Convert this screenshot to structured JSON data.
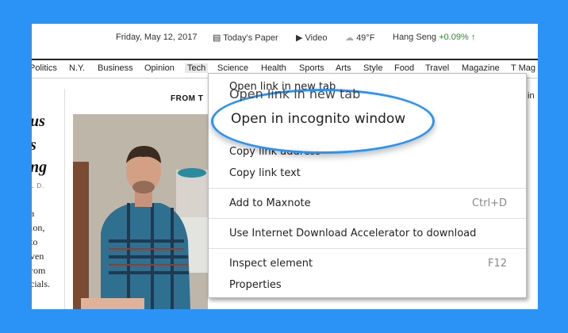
{
  "topbar": {
    "date": "Friday, May 12, 2017",
    "todays_paper": "Today's Paper",
    "video": "Video",
    "weather": "49°F",
    "market_name": "Hang Seng",
    "market_change": "+0.09% ↑"
  },
  "nav": {
    "items": [
      "Politics",
      "N.Y.",
      "Business",
      "Opinion",
      "Tech",
      "Science",
      "Health",
      "Sports",
      "Arts",
      "Style",
      "Food",
      "Travel",
      "Magazine",
      "T Mag"
    ]
  },
  "article": {
    "from_label": "FROM T",
    "headline_lines": [
      "us",
      "s",
      "ng"
    ],
    "byline": "L D.",
    "summary_lines": [
      "a",
      "ion,",
      "to",
      "ven",
      "rom",
      "cials."
    ],
    "right_snippet": "in"
  },
  "context_menu": {
    "items": [
      {
        "label": "Open link in new tab",
        "shortcut": ""
      },
      {
        "label": "Copy link address",
        "shortcut": ""
      },
      {
        "label": "Copy link text",
        "shortcut": ""
      },
      {
        "label": "Add to Maxnote",
        "shortcut": "Ctrl+D"
      },
      {
        "label": "Use Internet Download Accelerator to download",
        "shortcut": ""
      },
      {
        "label": "Inspect element",
        "shortcut": "F12"
      },
      {
        "label": "Properties",
        "shortcut": ""
      }
    ],
    "magnified_upper": "Open link in new tab",
    "highlighted": "Open in incognito window"
  },
  "colors": {
    "background": "#2a93f5",
    "callout_border": "#2a93f5",
    "market_up": "#2e8b2e"
  }
}
